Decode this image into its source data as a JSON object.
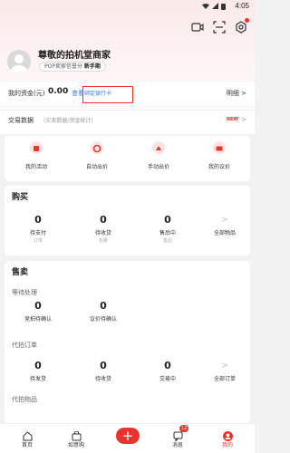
{
  "status": {
    "time": "4:05"
  },
  "profile": {
    "shop_name": "尊敬的拍机堂商家",
    "badge_prefix": "POP卖家信誉分",
    "badge_level": "新手期"
  },
  "fund": {
    "label": "我的资金(元)",
    "value": "0.00",
    "view": "查看",
    "bind_card": "绑定银行卡",
    "detail": "明细",
    "chevron": ">"
  },
  "trade": {
    "label": "交易数据",
    "sub": "(买卖数据/资金统计)",
    "new_badge": "NEW",
    "chevron": ">"
  },
  "quick": [
    {
      "label": "我的活动",
      "icon": "calendar-icon"
    },
    {
      "label": "自动出价",
      "icon": "auto-bid-icon"
    },
    {
      "label": "手动出价",
      "icon": "manual-bid-icon"
    },
    {
      "label": "我的议价",
      "icon": "bargain-icon"
    }
  ],
  "buy": {
    "title": "购买",
    "items": [
      {
        "num": "0",
        "label": "待支付",
        "sub": "订单"
      },
      {
        "num": "0",
        "label": "待收货",
        "sub": "包裹"
      },
      {
        "num": "0",
        "label": "售后中",
        "sub": "售后"
      }
    ],
    "all": {
      "arrow": ">",
      "label": "全部物品"
    }
  },
  "sell": {
    "title": "售卖",
    "pending": {
      "title": "等待处理",
      "items": [
        {
          "num": "0",
          "label": "竞拍待确认"
        },
        {
          "num": "0",
          "label": "议价待确认"
        }
      ]
    },
    "orders": {
      "title": "代拍订单",
      "items": [
        {
          "num": "0",
          "label": "待发货"
        },
        {
          "num": "0",
          "label": "待收货"
        },
        {
          "num": "0",
          "label": "交易中"
        }
      ],
      "all": {
        "arrow": ">",
        "label": "全部订单"
      }
    },
    "goods": {
      "title": "代拍物品"
    }
  },
  "tabbar": {
    "items": [
      {
        "label": "首页",
        "icon": "home-icon"
      },
      {
        "label": "如意购",
        "icon": "shop-icon"
      },
      {
        "label": "消息",
        "icon": "message-icon",
        "badge": "12"
      },
      {
        "label": "我的",
        "icon": "profile-icon"
      }
    ],
    "fab": "+"
  },
  "colors": {
    "accent": "#e8332f",
    "link": "#3a7bd5"
  }
}
